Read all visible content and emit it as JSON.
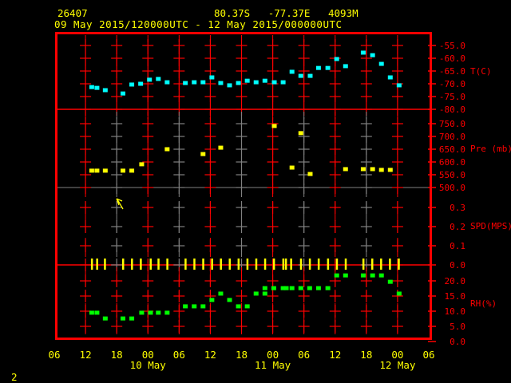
{
  "header": {
    "station": "26407",
    "location": "80.37S   -77.37E   4093M",
    "period": "09 May 2015/120000UTC - 12 May 2015/000000UTC"
  },
  "page_number": "2",
  "colors": {
    "frame": "#ff0000",
    "text": "#ffff00",
    "temperature": "#00ffff",
    "pressure": "#ffff00",
    "speed": "#ffff00",
    "humidity": "#00ff00",
    "separator": "#808080"
  },
  "chart_data": {
    "type": "scatter",
    "x_units": "hours since 09 May 2015 12 UTC",
    "xlim": [
      -6,
      66
    ],
    "x_tick_labels": [
      "06",
      "12",
      "18",
      "00",
      "06",
      "12",
      "18",
      "00",
      "06",
      "12",
      "18",
      "00",
      "06"
    ],
    "day_labels": [
      {
        "hour": 12,
        "label": "10 May"
      },
      {
        "hour": 36,
        "label": "11 May"
      },
      {
        "hour": 60,
        "label": "12 May"
      }
    ],
    "panels": [
      {
        "name": "temperature",
        "label": "T(C)",
        "ticks": [
          "-80.0",
          "-75.0",
          "-70.0",
          "-65.0",
          "-60.0",
          "-55.0"
        ],
        "tick_values": [
          -80,
          -75,
          -70,
          -65,
          -60,
          -55
        ],
        "points": [
          [
            1.2,
            -71.3
          ],
          [
            2.2,
            -71.6
          ],
          [
            3.8,
            -72.5
          ],
          [
            7.2,
            -73.8
          ],
          [
            8.9,
            -70.3
          ],
          [
            10.6,
            -70.0
          ],
          [
            12.3,
            -68.4
          ],
          [
            14,
            -68.1
          ],
          [
            15.7,
            -69.4
          ],
          [
            19.2,
            -69.7
          ],
          [
            20.9,
            -69.4
          ],
          [
            22.6,
            -69.4
          ],
          [
            24.3,
            -67.5
          ],
          [
            26,
            -69.7
          ],
          [
            27.7,
            -70.6
          ],
          [
            29.4,
            -69.7
          ],
          [
            31.1,
            -68.8
          ],
          [
            32.8,
            -69.4
          ],
          [
            34.5,
            -68.8
          ],
          [
            36.3,
            -69.4
          ],
          [
            38,
            -69.4
          ],
          [
            39.7,
            -65.3
          ],
          [
            41.4,
            -66.9
          ],
          [
            43.2,
            -66.9
          ],
          [
            44.8,
            -63.8
          ],
          [
            46.6,
            -63.8
          ],
          [
            48.3,
            -60.3
          ],
          [
            50,
            -63.1
          ],
          [
            53.4,
            -57.8
          ],
          [
            55.2,
            -58.8
          ],
          [
            56.9,
            -62.2
          ],
          [
            58.6,
            -67.5
          ],
          [
            60.3,
            -70.6
          ]
        ]
      },
      {
        "name": "pressure",
        "label": "Pre (mb)",
        "ticks": [
          "500.0",
          "550.0",
          "600.0",
          "650.0",
          "700.0",
          "750.0"
        ],
        "tick_values": [
          500,
          550,
          600,
          650,
          700,
          750
        ],
        "points": [
          [
            1.2,
            566
          ],
          [
            2.2,
            566
          ],
          [
            3.8,
            566
          ],
          [
            7.2,
            566
          ],
          [
            8.9,
            566
          ],
          [
            10.8,
            591
          ],
          [
            15.7,
            650
          ],
          [
            22.6,
            631
          ],
          [
            26,
            656
          ],
          [
            36.3,
            741
          ],
          [
            39.7,
            578
          ],
          [
            41.4,
            713
          ],
          [
            43.2,
            553
          ],
          [
            50,
            572
          ],
          [
            53.4,
            572
          ],
          [
            55.2,
            572
          ],
          [
            56.9,
            569
          ],
          [
            58.6,
            569
          ]
        ]
      },
      {
        "name": "speed",
        "label": "SPD(MPS)",
        "ticks": [
          "0.0",
          "0.1",
          "0.2",
          "0.3"
        ],
        "tick_values": [
          0,
          0.1,
          0.2,
          0.3
        ],
        "points": [
          [
            1.2,
            0
          ],
          [
            2.2,
            0
          ],
          [
            3.7,
            0
          ],
          [
            7.2,
            0
          ],
          [
            8.9,
            0
          ],
          [
            10.6,
            0
          ],
          [
            12.5,
            0
          ],
          [
            14,
            0
          ],
          [
            15.7,
            0
          ],
          [
            19.2,
            0
          ],
          [
            20.9,
            0
          ],
          [
            22.6,
            0
          ],
          [
            24.3,
            0
          ],
          [
            26,
            0
          ],
          [
            27.7,
            0
          ],
          [
            29.4,
            0
          ],
          [
            31.1,
            0
          ],
          [
            32.8,
            0
          ],
          [
            34.5,
            0
          ],
          [
            36.2,
            0
          ],
          [
            38,
            0
          ],
          [
            38.5,
            0
          ],
          [
            39.5,
            0
          ],
          [
            41.4,
            0
          ],
          [
            43.1,
            0
          ],
          [
            44.8,
            0
          ],
          [
            46.6,
            0
          ],
          [
            48.3,
            0
          ],
          [
            50,
            0
          ],
          [
            53.4,
            0
          ],
          [
            55.1,
            0
          ],
          [
            56.8,
            0
          ],
          [
            58.5,
            0
          ],
          [
            60.2,
            0
          ]
        ]
      },
      {
        "name": "humidity",
        "label": "RH(%)",
        "ticks": [
          "0.0",
          "5.0",
          "10.0",
          "15.0",
          "20.0"
        ],
        "tick_values": [
          0,
          5,
          10,
          15,
          20
        ],
        "points": [
          [
            1.2,
            9.5
          ],
          [
            2.2,
            9.5
          ],
          [
            3.8,
            7.6
          ],
          [
            7.2,
            7.6
          ],
          [
            8.9,
            7.6
          ],
          [
            10.8,
            9.5
          ],
          [
            12.5,
            9.5
          ],
          [
            14,
            9.5
          ],
          [
            15.7,
            9.5
          ],
          [
            19.2,
            11.6
          ],
          [
            20.9,
            11.6
          ],
          [
            22.6,
            11.6
          ],
          [
            24.3,
            13.7
          ],
          [
            26,
            15.8
          ],
          [
            27.7,
            13.7
          ],
          [
            29.4,
            11.6
          ],
          [
            31.1,
            11.6
          ],
          [
            32.8,
            15.8
          ],
          [
            34.5,
            15.8
          ],
          [
            34.5,
            17.6
          ],
          [
            36.2,
            17.6
          ],
          [
            38,
            17.6
          ],
          [
            38.6,
            17.6
          ],
          [
            39.7,
            17.6
          ],
          [
            41.4,
            17.6
          ],
          [
            43.1,
            17.6
          ],
          [
            44.8,
            17.6
          ],
          [
            46.6,
            17.6
          ],
          [
            48.3,
            21.8
          ],
          [
            50,
            21.8
          ],
          [
            53.4,
            21.8
          ],
          [
            55.2,
            21.8
          ],
          [
            56.9,
            21.8
          ],
          [
            58.6,
            19.7
          ],
          [
            60.3,
            15.8
          ]
        ]
      }
    ]
  }
}
